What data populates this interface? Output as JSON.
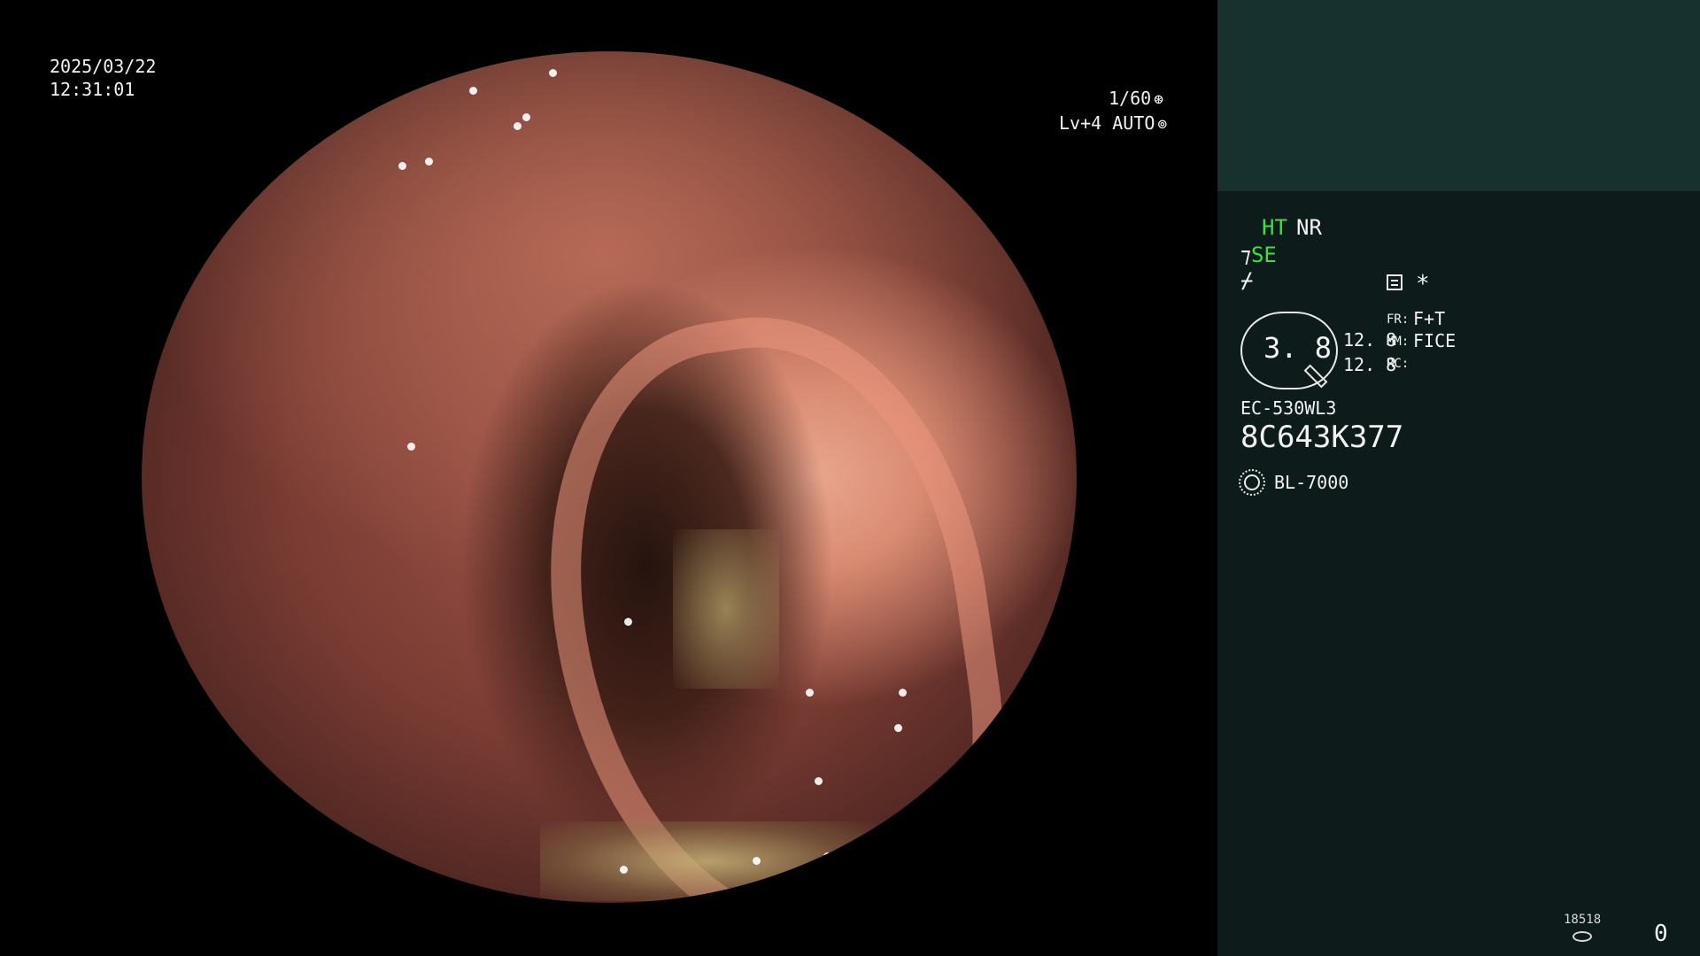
{
  "endoscope_view": {
    "date": "2025/03/22",
    "time": "12:31:01",
    "shutter": "1/60",
    "iris": "Lv+4 AUTO"
  },
  "info_panel": {
    "ht": "HT",
    "nr": "NR",
    "se": "SE",
    "zoom_value": "3. 8",
    "zoom_line_a": "12. 8",
    "zoom_line_b": "12. 8",
    "fr_label": "FR:",
    "fr_value": "F+T",
    "mm_label": "MM:",
    "mm_value": "FICE",
    "rc_label": "RC:",
    "scope_model": "EC-530WL3",
    "serial": "8C643K377",
    "light_source": "BL-7000",
    "counter_label": "18518",
    "counter_value": "0"
  },
  "colors": {
    "accent_green": "#39e23c",
    "panel_bg": "#0d1c1a",
    "panel_top_bg": "#16312e"
  },
  "icons": [
    "shutter-icon",
    "iris-icon",
    "scope-icon",
    "flash-icon",
    "memo-icon",
    "star-icon",
    "pen-icon",
    "light-icon",
    "disk-icon"
  ]
}
